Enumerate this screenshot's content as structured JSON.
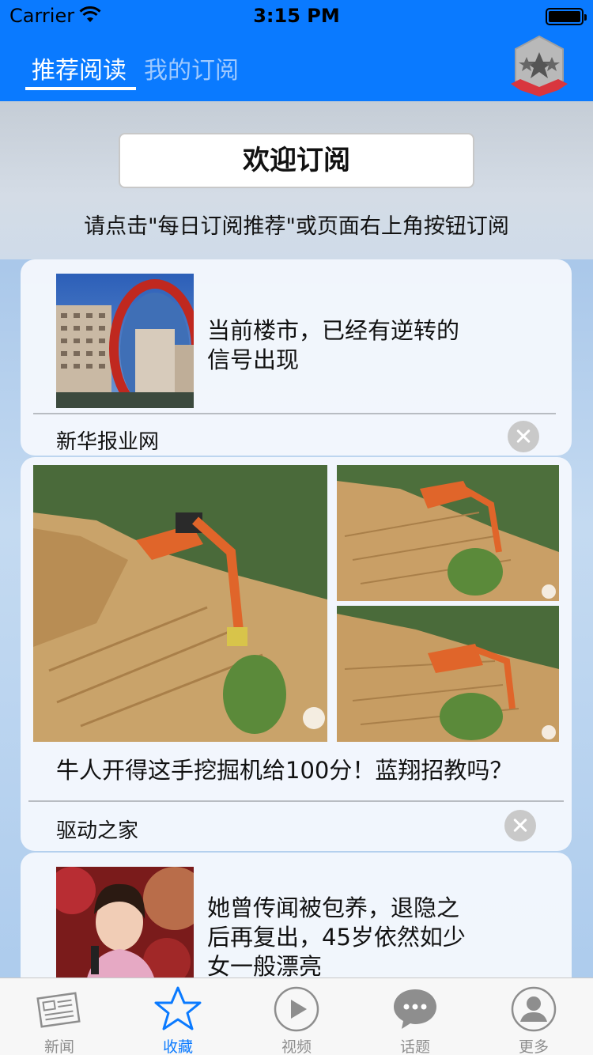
{
  "status_bar": {
    "carrier": "Carrier",
    "time": "3:15 PM"
  },
  "nav": {
    "tabs": [
      {
        "label": "推荐阅读",
        "active": true
      },
      {
        "label": "我的订阅",
        "active": false
      }
    ],
    "subscribe_icon": "badge-star-icon"
  },
  "welcome": {
    "button_label": "欢迎订阅",
    "hint": "请点击\"每日订阅推荐\"或页面右上角按钮订阅"
  },
  "feed": [
    {
      "title_line1": "当前楼市，已经有逆转的",
      "title_line2": "信号出现",
      "source": "新华报业网",
      "thumbnail": "building-convex-mirror-photo"
    },
    {
      "title": "牛人开得这手挖掘机给100分！蓝翔招教吗？",
      "source": "驱动之家",
      "images": [
        "excavator-on-slope-photo",
        "excavator-climbing-photo",
        "excavator-descending-photo"
      ]
    },
    {
      "title_line1": "她曾传闻被包养，退隐之",
      "title_line2": "后再复出，45岁依然如少",
      "title_line3": "女一般漂亮",
      "thumbnail": "woman-singing-photo"
    }
  ],
  "tabbar": {
    "items": [
      {
        "label": "新闻",
        "icon": "newspaper-icon",
        "active": false
      },
      {
        "label": "收藏",
        "icon": "star-icon",
        "active": true
      },
      {
        "label": "视频",
        "icon": "play-icon",
        "active": false
      },
      {
        "label": "话题",
        "icon": "chat-bubble-icon",
        "active": false
      },
      {
        "label": "更多",
        "icon": "user-icon",
        "active": false
      }
    ]
  },
  "colors": {
    "accent": "#0a7aff",
    "inactive": "#8e8e8e"
  }
}
